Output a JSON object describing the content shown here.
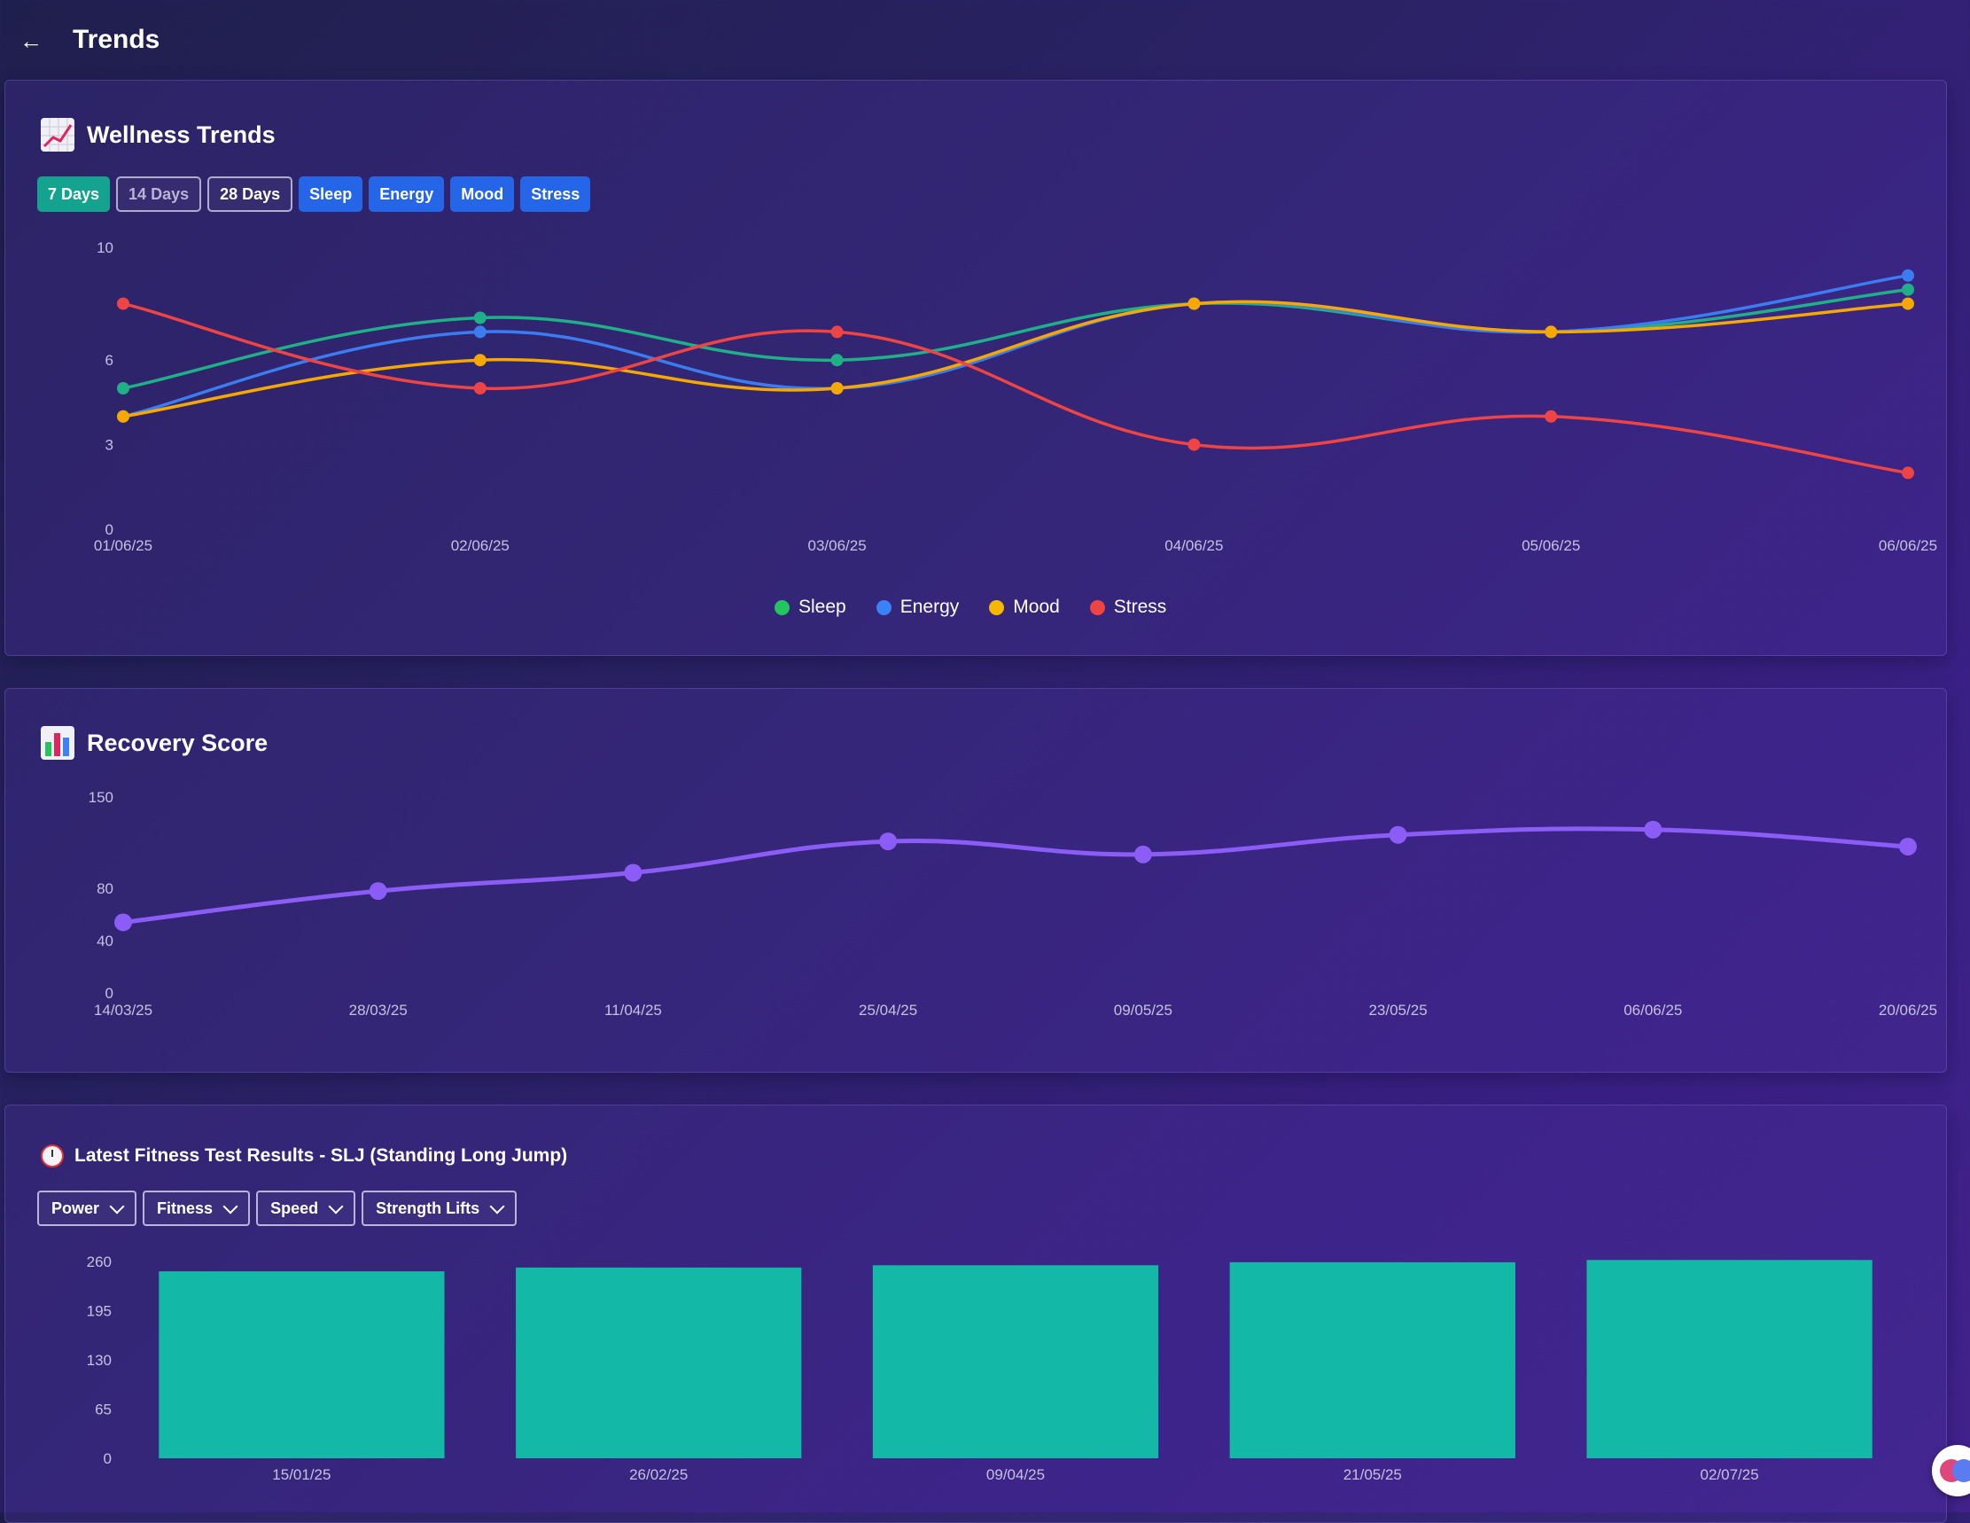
{
  "header": {
    "title": "Trends",
    "back_icon": "arrow-left-icon"
  },
  "wellness": {
    "title": "Wellness Trends",
    "icon": "chart-increasing-icon",
    "range_buttons": [
      "7 Days",
      "14 Days",
      "28 Days"
    ],
    "metric_buttons": [
      "Sleep",
      "Energy",
      "Mood",
      "Stress"
    ],
    "legend": [
      {
        "name": "Sleep",
        "color": "#22c55e"
      },
      {
        "name": "Energy",
        "color": "#3b82f6"
      },
      {
        "name": "Mood",
        "color": "#f5b800"
      },
      {
        "name": "Stress",
        "color": "#ef4444"
      }
    ]
  },
  "recovery": {
    "title": "Recovery Score",
    "icon": "bar-chart-icon"
  },
  "fitness": {
    "title": "Latest Fitness Test Results - SLJ (Standing Long Jump)",
    "icon": "stopwatch-icon",
    "dropdowns": [
      "Power",
      "Fitness",
      "Speed",
      "Strength Lifts"
    ]
  },
  "chart_data": [
    {
      "type": "line",
      "title": "Wellness Trends",
      "x": [
        "01/06/25",
        "02/06/25",
        "03/06/25",
        "04/06/25",
        "05/06/25",
        "06/06/25"
      ],
      "yticks": [
        0,
        3,
        6,
        10
      ],
      "ylim": [
        0,
        10
      ],
      "legend": "bottom-center",
      "series": [
        {
          "name": "Sleep",
          "color": "#1fb087",
          "values": [
            5,
            7.5,
            6,
            8,
            7,
            8.5
          ]
        },
        {
          "name": "Energy",
          "color": "#3b7df0",
          "values": [
            4,
            7,
            5,
            8,
            7,
            9
          ]
        },
        {
          "name": "Mood",
          "color": "#f5a800",
          "values": [
            4,
            6,
            5,
            8,
            7,
            8
          ]
        },
        {
          "name": "Stress",
          "color": "#ef4444",
          "values": [
            8,
            5,
            7,
            3,
            4,
            2
          ]
        }
      ]
    },
    {
      "type": "line",
      "title": "Recovery Score",
      "x": [
        "14/03/25",
        "28/03/25",
        "11/04/25",
        "25/04/25",
        "09/05/25",
        "23/05/25",
        "06/06/25",
        "20/06/25"
      ],
      "yticks": [
        0,
        40,
        80,
        150
      ],
      "ylim": [
        0,
        150
      ],
      "series": [
        {
          "name": "Recovery Score",
          "color": "#8b5cf6",
          "values": [
            54,
            78,
            92,
            116,
            106,
            121,
            125,
            112
          ]
        }
      ]
    },
    {
      "type": "bar",
      "title": "Latest Fitness Test Results - SLJ (Standing Long Jump)",
      "categories": [
        "15/01/25",
        "26/02/25",
        "09/04/25",
        "21/05/25",
        "02/07/25"
      ],
      "values": [
        247,
        252,
        255,
        259,
        262
      ],
      "yticks": [
        0,
        65,
        130,
        195,
        260
      ],
      "ylim": [
        0,
        260
      ],
      "color": "#14b8a6"
    }
  ]
}
